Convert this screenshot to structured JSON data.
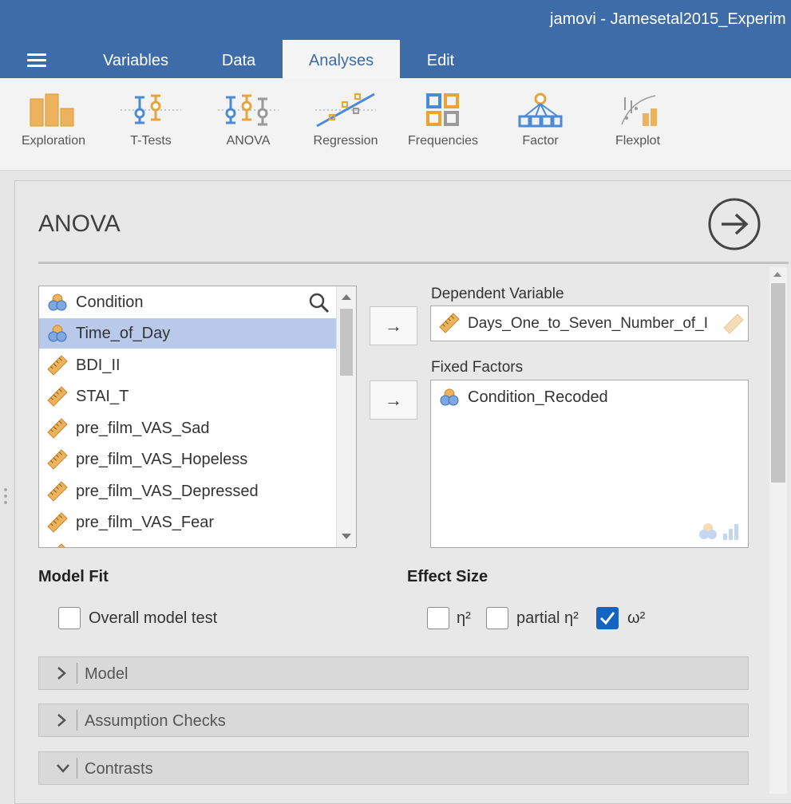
{
  "window": {
    "title": "jamovi - Jamesetal2015_Experim"
  },
  "tabs": [
    {
      "label": "Variables"
    },
    {
      "label": "Data"
    },
    {
      "label": "Analyses"
    },
    {
      "label": "Edit"
    }
  ],
  "active_tab": "Analyses",
  "ribbon": {
    "tools": [
      {
        "label": "Exploration",
        "icon": "exploration-icon"
      },
      {
        "label": "T-Tests",
        "icon": "t-tests-icon"
      },
      {
        "label": "ANOVA",
        "icon": "anova-icon"
      },
      {
        "label": "Regression",
        "icon": "regression-icon"
      },
      {
        "label": "Frequencies",
        "icon": "frequencies-icon"
      },
      {
        "label": "Factor",
        "icon": "factor-icon"
      },
      {
        "label": "Flexplot",
        "icon": "flexplot-icon"
      }
    ]
  },
  "analysis": {
    "title": "ANOVA",
    "variables": [
      {
        "name": "Condition",
        "type": "nominal"
      },
      {
        "name": "Time_of_Day",
        "type": "nominal",
        "selected": true
      },
      {
        "name": "BDI_II",
        "type": "continuous"
      },
      {
        "name": "STAI_T",
        "type": "continuous"
      },
      {
        "name": "pre_film_VAS_Sad",
        "type": "continuous"
      },
      {
        "name": "pre_film_VAS_Hopeless",
        "type": "continuous"
      },
      {
        "name": "pre_film_VAS_Depressed",
        "type": "continuous"
      },
      {
        "name": "pre_film_VAS_Fear",
        "type": "continuous"
      }
    ],
    "dependent_label": "Dependent Variable",
    "dependent_value": "Days_One_to_Seven_Number_of_In...",
    "fixed_label": "Fixed Factors",
    "fixed_factors": [
      {
        "name": "Condition_Recoded",
        "type": "nominal"
      }
    ],
    "move_symbol": "→"
  },
  "model_fit": {
    "heading": "Model Fit",
    "overall_label": "Overall model test",
    "overall_checked": false
  },
  "effect_size": {
    "heading": "Effect Size",
    "eta_label": "η²",
    "eta_checked": false,
    "partial_label": "partial η²",
    "partial_checked": false,
    "omega_label": "ω²",
    "omega_checked": true
  },
  "sections": [
    {
      "label": "Model",
      "expanded": false
    },
    {
      "label": "Assumption Checks",
      "expanded": false
    },
    {
      "label": "Contrasts",
      "expanded": true
    }
  ],
  "colors": {
    "brand": "#3e6ca9",
    "selection": "#b8c9ea",
    "checkbox_on": "#1565c0",
    "orange": "#e6a43c",
    "blue": "#4a8ad6"
  }
}
